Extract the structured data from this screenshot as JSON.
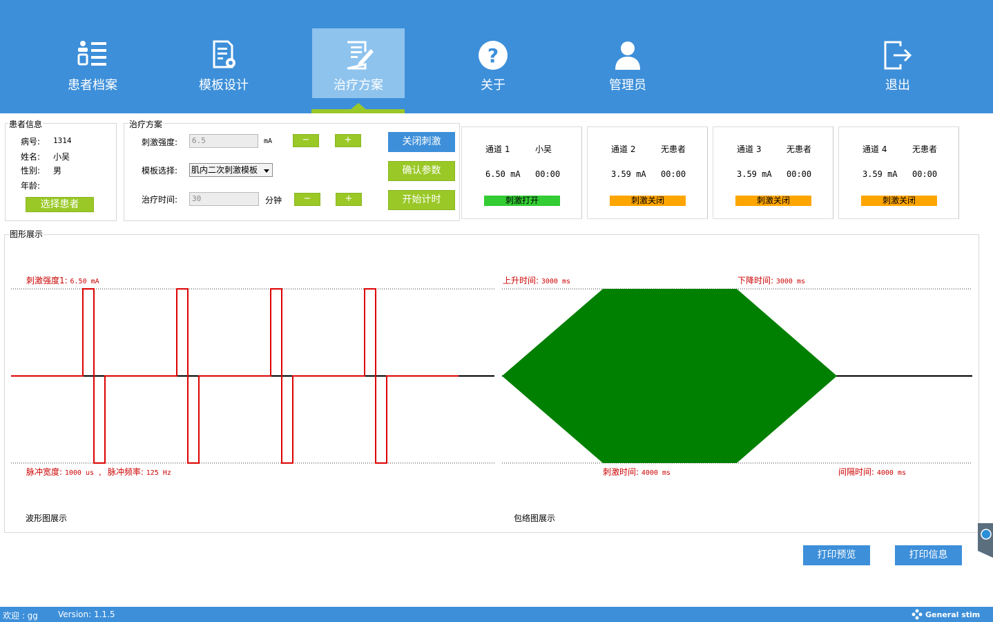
{
  "nav": {
    "items": [
      {
        "label": "患者档案",
        "icon": "patient-list-icon"
      },
      {
        "label": "模板设计",
        "icon": "template-settings-icon"
      },
      {
        "label": "治疗方案",
        "icon": "edit-plan-icon"
      },
      {
        "label": "关于",
        "icon": "help-icon"
      },
      {
        "label": "管理员",
        "icon": "user-icon"
      },
      {
        "label": "退出",
        "icon": "logout-icon"
      }
    ],
    "active_index": 2
  },
  "patient": {
    "section_label": "患者信息",
    "id_label": "病号:",
    "id_value": "1314",
    "name_label": "姓名:",
    "name_value": "小吴",
    "gender_label": "性别:",
    "gender_value": "男",
    "age_label": "年龄:",
    "age_value": "",
    "select_button": "选择患者"
  },
  "plan": {
    "section_label": "治疗方案",
    "intensity_label": "刺激强度:",
    "intensity_value": "6.5",
    "intensity_unit": "mA",
    "template_label": "模板选择:",
    "template_value": "肌内二次刺激模板",
    "time_label": "治疗时间:",
    "time_value": "30",
    "time_unit": "分钟",
    "minus": "−",
    "plus": "+",
    "stop_button": "关闭刺激",
    "confirm_button": "确认参数",
    "start_timer_button": "开始计时"
  },
  "channels": [
    {
      "name": "通道 1",
      "patient": "小吴",
      "current": "6.50 mA",
      "time": "00:00",
      "status": "刺激打开",
      "status_color": "#33cc33"
    },
    {
      "name": "通道 2",
      "patient": "无患者",
      "current": "3.59 mA",
      "time": "00:00",
      "status": "刺激关闭",
      "status_color": "#ffa500"
    },
    {
      "name": "通道 3",
      "patient": "无患者",
      "current": "3.59 mA",
      "time": "00:00",
      "status": "刺激关闭",
      "status_color": "#ffa500"
    },
    {
      "name": "通道 4",
      "patient": "无患者",
      "current": "3.59 mA",
      "time": "00:00",
      "status": "刺激关闭",
      "status_color": "#ffa500"
    }
  ],
  "graph": {
    "section_label": "图形展示",
    "waveform": {
      "intensity_label": "刺激强度1:",
      "intensity_value": "6.50 mA",
      "pulse_width_label": "脉冲宽度:",
      "pulse_width_value": "1000 us ,",
      "pulse_freq_label": "脉冲频率:",
      "pulse_freq_value": "125 Hz",
      "caption": "波形图展示",
      "pulses": 4
    },
    "envelope": {
      "rise_label": "上升时间:",
      "rise_value": "3000 ms",
      "fall_label": "下降时间:",
      "fall_value": "3000 ms",
      "stim_label": "刺激时间:",
      "stim_value": "4000 ms",
      "interval_label": "间隔时间:",
      "interval_value": "4000 ms",
      "caption": "包络图展示",
      "fill_color": "#008000"
    }
  },
  "actions": {
    "print_preview": "打印预览",
    "print_info": "打印信息"
  },
  "status": {
    "welcome": "欢迎 :  gg",
    "version": "Version: 1.1.5",
    "brand": "General stim"
  },
  "colors": {
    "primary": "#3d8fd9",
    "accent_green": "#9ac827",
    "wave_red": "#dd0000"
  }
}
